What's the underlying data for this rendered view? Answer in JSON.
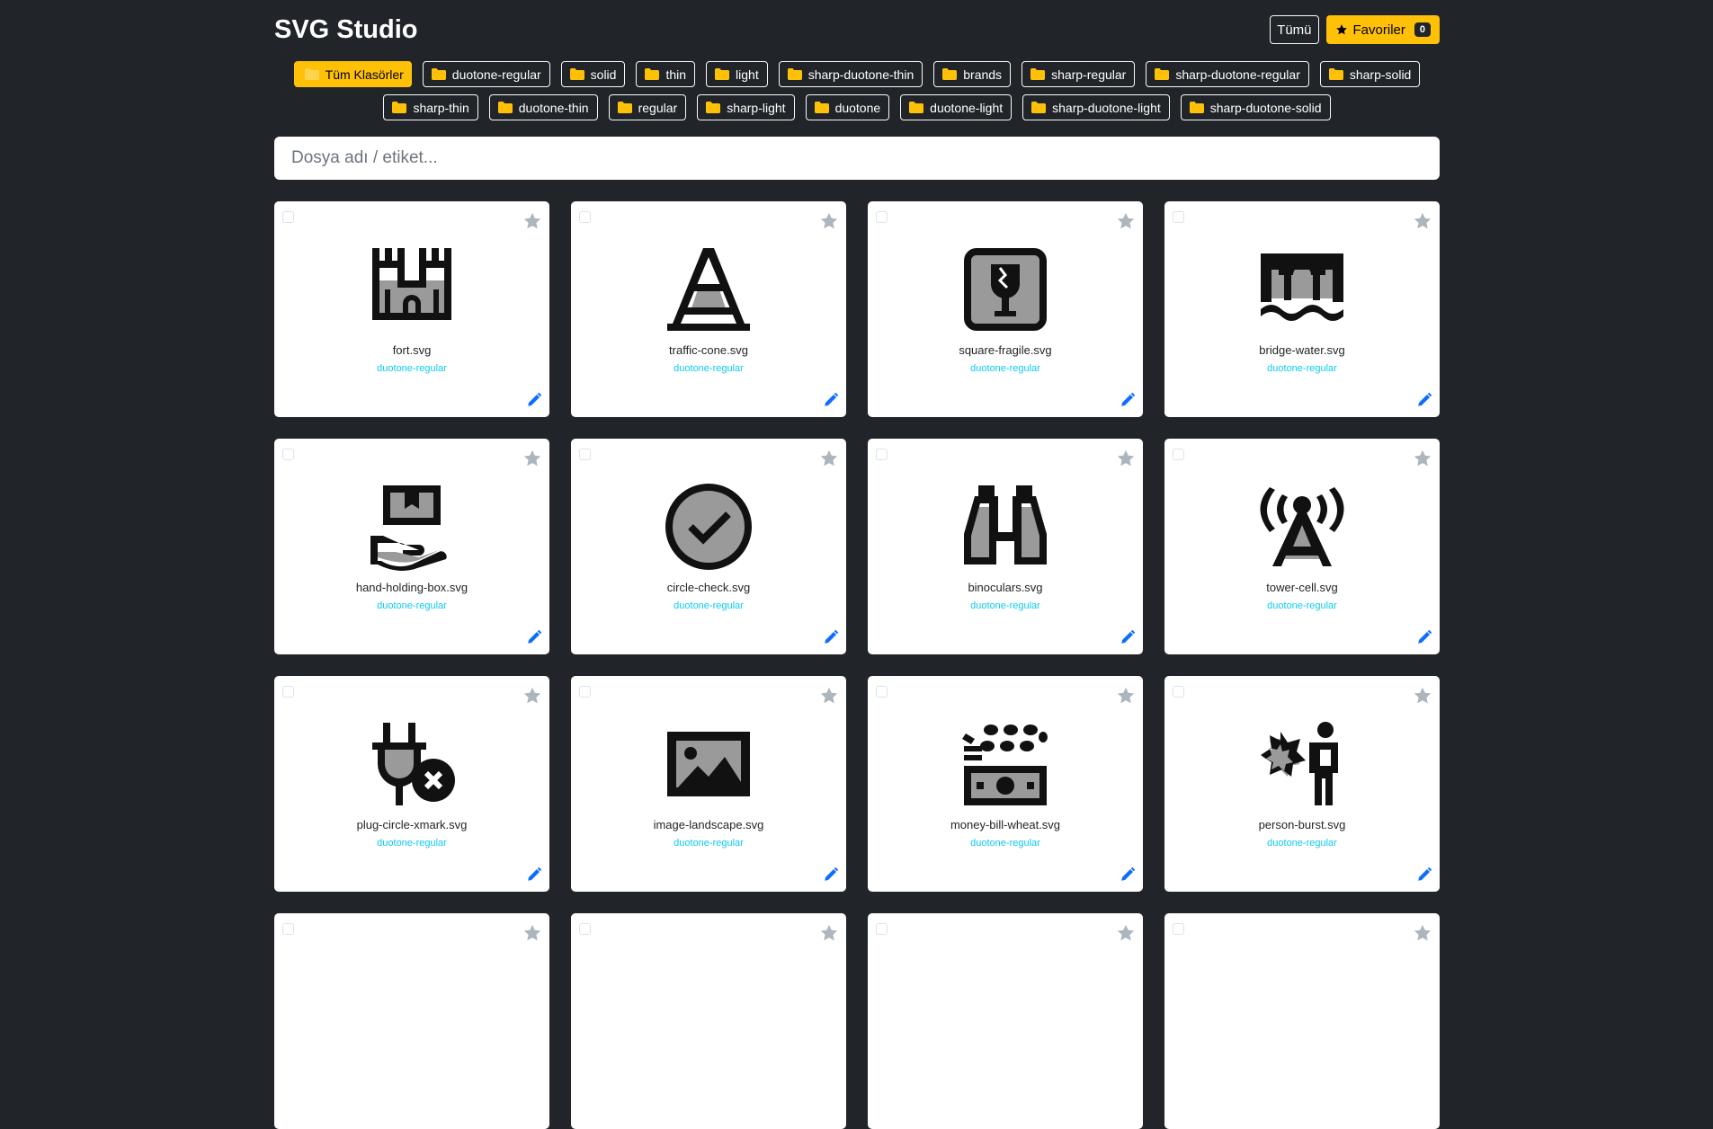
{
  "app": {
    "title": "SVG Studio"
  },
  "header": {
    "all_label": "Tümü",
    "favorites_label": "Favoriler",
    "favorites_count": "0"
  },
  "folders": [
    {
      "label": "Tüm Klasörler",
      "active": true
    },
    {
      "label": "duotone-regular"
    },
    {
      "label": "solid"
    },
    {
      "label": "thin"
    },
    {
      "label": "light"
    },
    {
      "label": "sharp-duotone-thin"
    },
    {
      "label": "brands"
    },
    {
      "label": "sharp-regular"
    },
    {
      "label": "sharp-duotone-regular"
    },
    {
      "label": "sharp-solid"
    },
    {
      "label": "sharp-thin"
    },
    {
      "label": "duotone-thin"
    },
    {
      "label": "regular"
    },
    {
      "label": "sharp-light"
    },
    {
      "label": "duotone"
    },
    {
      "label": "duotone-light"
    },
    {
      "label": "sharp-duotone-light"
    },
    {
      "label": "sharp-duotone-solid"
    }
  ],
  "search": {
    "placeholder": "Dosya adı / etiket..."
  },
  "cards": [
    {
      "name": "fort.svg",
      "folder": "duotone-regular",
      "icon": "fort-icon"
    },
    {
      "name": "traffic-cone.svg",
      "folder": "duotone-regular",
      "icon": "traffic-cone-icon"
    },
    {
      "name": "square-fragile.svg",
      "folder": "duotone-regular",
      "icon": "square-fragile-icon"
    },
    {
      "name": "bridge-water.svg",
      "folder": "duotone-regular",
      "icon": "bridge-water-icon"
    },
    {
      "name": "hand-holding-box.svg",
      "folder": "duotone-regular",
      "icon": "hand-holding-box-icon"
    },
    {
      "name": "circle-check.svg",
      "folder": "duotone-regular",
      "icon": "circle-check-icon"
    },
    {
      "name": "binoculars.svg",
      "folder": "duotone-regular",
      "icon": "binoculars-icon"
    },
    {
      "name": "tower-cell.svg",
      "folder": "duotone-regular",
      "icon": "tower-cell-icon"
    },
    {
      "name": "plug-circle-xmark.svg",
      "folder": "duotone-regular",
      "icon": "plug-circle-xmark-icon"
    },
    {
      "name": "image-landscape.svg",
      "folder": "duotone-regular",
      "icon": "image-landscape-icon"
    },
    {
      "name": "money-bill-wheat.svg",
      "folder": "duotone-regular",
      "icon": "money-bill-wheat-icon"
    },
    {
      "name": "person-burst.svg",
      "folder": "duotone-regular",
      "icon": "person-burst-icon"
    }
  ],
  "colors": {
    "background": "#212529",
    "accent": "#ffc107",
    "tag": "#0dcaf0",
    "edit": "#0d6efd",
    "star": "#adb5bd"
  }
}
